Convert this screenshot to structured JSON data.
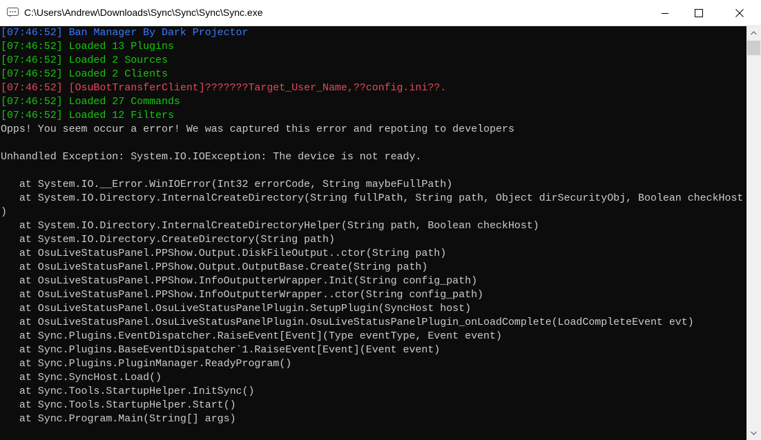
{
  "window": {
    "title": "C:\\Users\\Andrew\\Downloads\\Sync\\Sync\\Sync\\Sync.exe",
    "icon": "console-app-icon"
  },
  "console": {
    "lines": [
      {
        "text": "[07:46:52] Ban Manager By Dark Projector",
        "color": "blue"
      },
      {
        "text": "[07:46:52] Loaded 13 Plugins",
        "color": "green"
      },
      {
        "text": "[07:46:52] Loaded 2 Sources",
        "color": "green"
      },
      {
        "text": "[07:46:52] Loaded 2 Clients",
        "color": "green"
      },
      {
        "text": "[07:46:52] [OsuBotTransferClient]???????Target_User_Name,??config.ini??.",
        "color": "red"
      },
      {
        "text": "[07:46:52] Loaded 27 Commands",
        "color": "green"
      },
      {
        "text": "[07:46:52] Loaded 12 Filters",
        "color": "green"
      },
      {
        "text": "Opps! You seem occur a error! We was captured this error and repoting to developers",
        "color": "white"
      },
      {
        "text": "",
        "color": "white"
      },
      {
        "text": "Unhandled Exception: System.IO.IOException: The device is not ready.",
        "color": "white"
      },
      {
        "text": "",
        "color": "white"
      },
      {
        "text": "   at System.IO.__Error.WinIOError(Int32 errorCode, String maybeFullPath)",
        "color": "white"
      },
      {
        "text": "   at System.IO.Directory.InternalCreateDirectory(String fullPath, String path, Object dirSecurityObj, Boolean checkHost",
        "color": "white"
      },
      {
        "text": ")",
        "color": "white"
      },
      {
        "text": "   at System.IO.Directory.InternalCreateDirectoryHelper(String path, Boolean checkHost)",
        "color": "white"
      },
      {
        "text": "   at System.IO.Directory.CreateDirectory(String path)",
        "color": "white"
      },
      {
        "text": "   at OsuLiveStatusPanel.PPShow.Output.DiskFileOutput..ctor(String path)",
        "color": "white"
      },
      {
        "text": "   at OsuLiveStatusPanel.PPShow.Output.OutputBase.Create(String path)",
        "color": "white"
      },
      {
        "text": "   at OsuLiveStatusPanel.PPShow.InfoOutputterWrapper.Init(String config_path)",
        "color": "white"
      },
      {
        "text": "   at OsuLiveStatusPanel.PPShow.InfoOutputterWrapper..ctor(String config_path)",
        "color": "white"
      },
      {
        "text": "   at OsuLiveStatusPanel.OsuLiveStatusPanelPlugin.SetupPlugin(SyncHost host)",
        "color": "white"
      },
      {
        "text": "   at OsuLiveStatusPanel.OsuLiveStatusPanelPlugin.OsuLiveStatusPanelPlugin_onLoadComplete(LoadCompleteEvent evt)",
        "color": "white"
      },
      {
        "text": "   at Sync.Plugins.EventDispatcher.RaiseEvent[Event](Type eventType, Event event)",
        "color": "white"
      },
      {
        "text": "   at Sync.Plugins.BaseEventDispatcher`1.RaiseEvent[Event](Event event)",
        "color": "white"
      },
      {
        "text": "   at Sync.Plugins.PluginManager.ReadyProgram()",
        "color": "white"
      },
      {
        "text": "   at Sync.SyncHost.Load()",
        "color": "white"
      },
      {
        "text": "   at Sync.Tools.StartupHelper.InitSync()",
        "color": "white"
      },
      {
        "text": "   at Sync.Tools.StartupHelper.Start()",
        "color": "white"
      },
      {
        "text": "   at Sync.Program.Main(String[] args)",
        "color": "white"
      }
    ]
  },
  "colors": {
    "background": "#0c0c0c",
    "blue": "#3b78ff",
    "green": "#16c60c",
    "red": "#e74856",
    "white": "#cccccc",
    "titlebar": "#ffffff"
  }
}
